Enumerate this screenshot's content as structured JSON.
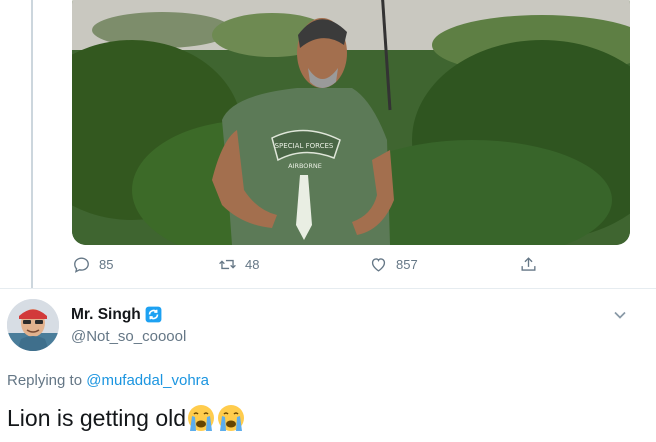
{
  "tweet": {
    "actions": {
      "replies": "85",
      "retweets": "48",
      "likes": "857"
    },
    "media": {
      "shirt_text_line1": "SPECIAL FORCES",
      "shirt_text_line2": "AIRBORNE"
    }
  },
  "reply": {
    "display_name": "Mr. Singh",
    "handle": "@Not_so_cooool",
    "replying_label": "Replying to",
    "replying_to": "@mufaddal_vohra",
    "text": "Lion is getting old",
    "emojis": [
      "crying-face-emoji",
      "crying-face-emoji"
    ]
  },
  "colors": {
    "accent": "#1b95e0",
    "muted": "#657786",
    "divider": "#e6ecf0",
    "verified": "#1da1f2"
  }
}
